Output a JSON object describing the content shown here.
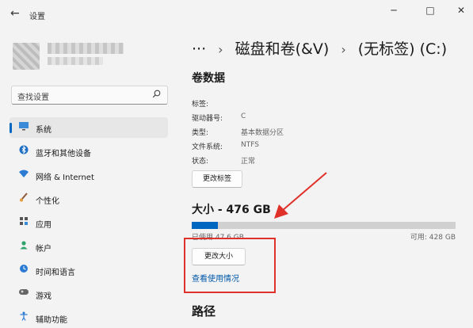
{
  "window": {
    "title": "设置",
    "back_glyph": "←",
    "minimize_glyph": "─",
    "maximize_glyph": "□",
    "close_glyph": "✕"
  },
  "search": {
    "placeholder": "查找设置",
    "icon": "search-icon"
  },
  "sidebar": {
    "items": [
      {
        "label": "系统",
        "icon": "monitor-icon",
        "selected": true
      },
      {
        "label": "蓝牙和其他设备",
        "icon": "bluetooth-icon"
      },
      {
        "label": "网络 & Internet",
        "icon": "wifi-icon"
      },
      {
        "label": "个性化",
        "icon": "brush-icon"
      },
      {
        "label": "应用",
        "icon": "apps-icon"
      },
      {
        "label": "帐户",
        "icon": "person-icon"
      },
      {
        "label": "时间和语言",
        "icon": "clock-globe-icon"
      },
      {
        "label": "游戏",
        "icon": "gamepad-icon"
      },
      {
        "label": "辅助功能",
        "icon": "accessibility-icon"
      }
    ]
  },
  "breadcrumb": {
    "more": "···",
    "separator": "›",
    "parent": "磁盘和卷(&V)",
    "current": "(无标签) (C:)"
  },
  "volume": {
    "heading": "卷数据",
    "rows": [
      {
        "label": "标签:",
        "value": ""
      },
      {
        "label": "驱动器号:",
        "value": "C"
      },
      {
        "label": "类型:",
        "value": "基本数据分区"
      },
      {
        "label": "文件系统:",
        "value": "NTFS"
      },
      {
        "label": "状态:",
        "value": "正常"
      }
    ],
    "change_label_button": "更改标签"
  },
  "size": {
    "heading": "大小 - 476 GB",
    "used_text": "已使用 47.6 GB",
    "free_text": "可用: 428 GB",
    "used_fraction": 0.1,
    "resize_button": "更改大小",
    "usage_link": "查看使用情况"
  },
  "path": {
    "heading": "路径"
  },
  "colors": {
    "accent": "#0067c0",
    "annotation": "#e0302a"
  }
}
